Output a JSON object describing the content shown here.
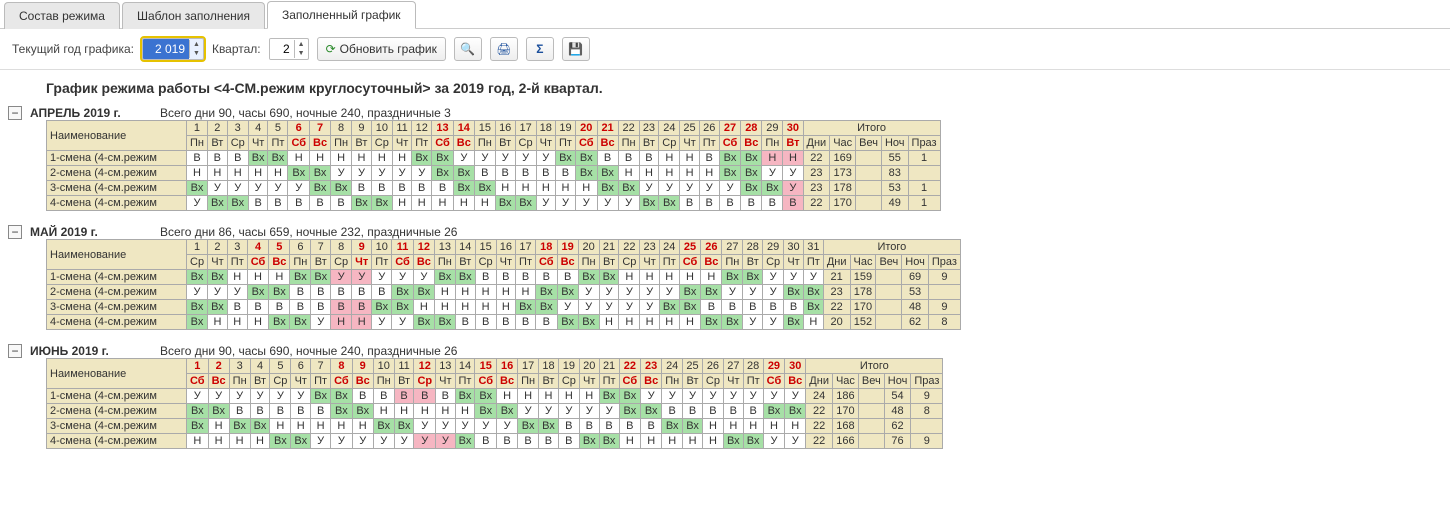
{
  "tabs": {
    "t0": "Состав режима",
    "t1": "Шаблон заполнения",
    "t2": "Заполненный график",
    "active": 2
  },
  "toolbar": {
    "year_label": "Текущий год графика:",
    "year": "2 019",
    "quarter_label": "Квартал:",
    "quarter": "2",
    "refresh": "Обновить график"
  },
  "title": "График режима работы <4-СМ.режим круглосуточный> за 2019 год, 2-й квартал.",
  "cols": {
    "name": "Наименование",
    "totals_header": "Итого",
    "totals": [
      "Дни",
      "Час",
      "Веч",
      "Ноч",
      "Праз"
    ]
  },
  "months": [
    {
      "name": "АПРЕЛЬ 2019 г.",
      "sub": "Всего дни 90, часы 690, ночные 240, праздничные 3",
      "day_nums": [
        "1",
        "2",
        "3",
        "4",
        "5",
        "6",
        "7",
        "8",
        "9",
        "10",
        "11",
        "12",
        "13",
        "14",
        "15",
        "16",
        "17",
        "18",
        "19",
        "20",
        "21",
        "22",
        "23",
        "24",
        "25",
        "26",
        "27",
        "28",
        "29",
        "30"
      ],
      "red_nums": [
        6,
        7,
        13,
        14,
        20,
        21,
        27,
        28,
        30
      ],
      "dows": [
        "Пн",
        "Вт",
        "Ср",
        "Чт",
        "Пт",
        "Сб",
        "Вс",
        "Пн",
        "Вт",
        "Ср",
        "Чт",
        "Пт",
        "Сб",
        "Вс",
        "Пн",
        "Вт",
        "Ср",
        "Чт",
        "Пт",
        "Сб",
        "Вс",
        "Пн",
        "Вт",
        "Ср",
        "Чт",
        "Пт",
        "Сб",
        "Вс",
        "Пн",
        "Вт"
      ],
      "red_dows": [
        6,
        7,
        13,
        14,
        20,
        21,
        27,
        28,
        30
      ],
      "rows": [
        {
          "name": "1-смена (4-см.режим",
          "cells": [
            "В",
            "В",
            "В",
            "Вх",
            "Вх",
            "Н",
            "Н",
            "Н",
            "Н",
            "Н",
            "Н",
            "Вх",
            "Вх",
            "У",
            "У",
            "У",
            "У",
            "У",
            "Вх",
            "Вх",
            "В",
            "В",
            "В",
            "Н",
            "Н",
            "В",
            "Вх",
            "Вх",
            "Н",
            "Н"
          ],
          "vx": [
            4,
            5,
            12,
            13,
            19,
            20,
            27,
            28
          ],
          "hol": [
            29,
            30
          ],
          "totals": [
            "22",
            "169",
            "",
            "55",
            "1"
          ]
        },
        {
          "name": "2-смена (4-см.режим",
          "cells": [
            "Н",
            "Н",
            "Н",
            "Н",
            "Н",
            "Вх",
            "Вх",
            "У",
            "У",
            "У",
            "У",
            "У",
            "Вх",
            "Вх",
            "В",
            "В",
            "В",
            "В",
            "В",
            "Вх",
            "Вх",
            "Н",
            "Н",
            "Н",
            "Н",
            "Н",
            "Вх",
            "Вх",
            "У",
            "У"
          ],
          "vx": [
            6,
            7,
            13,
            14,
            20,
            21,
            27,
            28
          ],
          "hol": [],
          "totals": [
            "23",
            "173",
            "",
            "83",
            ""
          ]
        },
        {
          "name": "3-смена (4-см.режим",
          "cells": [
            "Вх",
            "У",
            "У",
            "У",
            "У",
            "У",
            "Вх",
            "Вх",
            "В",
            "В",
            "В",
            "В",
            "В",
            "Вх",
            "Вх",
            "Н",
            "Н",
            "Н",
            "Н",
            "Н",
            "Вх",
            "Вх",
            "У",
            "У",
            "У",
            "У",
            "У",
            "Вх",
            "Вх",
            "У"
          ],
          "vx": [
            1,
            7,
            8,
            14,
            15,
            21,
            22,
            28,
            29
          ],
          "hol": [
            30
          ],
          "totals": [
            "23",
            "178",
            "",
            "53",
            "1"
          ]
        },
        {
          "name": "4-смена (4-см.режим",
          "cells": [
            "У",
            "Вх",
            "Вх",
            "В",
            "В",
            "В",
            "В",
            "В",
            "Вх",
            "Вх",
            "Н",
            "Н",
            "Н",
            "Н",
            "Н",
            "Вх",
            "Вх",
            "У",
            "У",
            "У",
            "У",
            "У",
            "Вх",
            "Вх",
            "В",
            "В",
            "В",
            "В",
            "В",
            "В"
          ],
          "vx": [
            2,
            3,
            9,
            10,
            16,
            17,
            23,
            24
          ],
          "hol": [
            30
          ],
          "totals": [
            "22",
            "170",
            "",
            "49",
            "1"
          ]
        }
      ]
    },
    {
      "name": "МАЙ 2019 г.",
      "sub": "Всего дни 86, часы 659, ночные 232, праздничные 26",
      "day_nums": [
        "1",
        "2",
        "3",
        "4",
        "5",
        "6",
        "7",
        "8",
        "9",
        "10",
        "11",
        "12",
        "13",
        "14",
        "15",
        "16",
        "17",
        "18",
        "19",
        "20",
        "21",
        "22",
        "23",
        "24",
        "25",
        "26",
        "27",
        "28",
        "29",
        "30",
        "31"
      ],
      "red_nums": [
        4,
        5,
        9,
        11,
        12,
        18,
        19,
        25,
        26
      ],
      "dows": [
        "Ср",
        "Чт",
        "Пт",
        "Сб",
        "Вс",
        "Пн",
        "Вт",
        "Ср",
        "Чт",
        "Пт",
        "Сб",
        "Вс",
        "Пн",
        "Вт",
        "Ср",
        "Чт",
        "Пт",
        "Сб",
        "Вс",
        "Пн",
        "Вт",
        "Ср",
        "Чт",
        "Пт",
        "Сб",
        "Вс",
        "Пн",
        "Вт",
        "Ср",
        "Чт",
        "Пт"
      ],
      "red_dows": [
        4,
        5,
        9,
        11,
        12,
        18,
        19,
        25,
        26
      ],
      "rows": [
        {
          "name": "1-смена (4-см.режим",
          "cells": [
            "Вх",
            "Вх",
            "Н",
            "Н",
            "Н",
            "Вх",
            "Вх",
            "У",
            "У",
            "У",
            "У",
            "У",
            "Вх",
            "Вх",
            "В",
            "В",
            "В",
            "В",
            "В",
            "Вх",
            "Вх",
            "Н",
            "Н",
            "Н",
            "Н",
            "Н",
            "Вх",
            "Вх",
            "У",
            "У",
            "У"
          ],
          "vx": [
            1,
            2,
            6,
            7,
            13,
            14,
            20,
            21,
            27,
            28
          ],
          "hol": [
            8,
            9
          ],
          "totals": [
            "21",
            "159",
            "",
            "69",
            "9"
          ]
        },
        {
          "name": "2-смена (4-см.режим",
          "cells": [
            "У",
            "У",
            "У",
            "Вх",
            "Вх",
            "В",
            "В",
            "В",
            "В",
            "В",
            "Вх",
            "Вх",
            "Н",
            "Н",
            "Н",
            "Н",
            "Н",
            "Вх",
            "Вх",
            "У",
            "У",
            "У",
            "У",
            "У",
            "Вх",
            "Вх",
            "У",
            "У",
            "У",
            "Вх",
            "Вх"
          ],
          "vx": [
            4,
            5,
            11,
            12,
            18,
            19,
            25,
            26,
            30,
            31
          ],
          "hol": [],
          "totals": [
            "23",
            "178",
            "",
            "53",
            ""
          ]
        },
        {
          "name": "3-смена (4-см.режим",
          "cells": [
            "Вх",
            "Вх",
            "В",
            "В",
            "В",
            "В",
            "В",
            "В",
            "В",
            "Вх",
            "Вх",
            "Н",
            "Н",
            "Н",
            "Н",
            "Н",
            "Вх",
            "Вх",
            "У",
            "У",
            "У",
            "У",
            "У",
            "Вх",
            "Вх",
            "В",
            "В",
            "В",
            "В",
            "В",
            "Вх"
          ],
          "vx": [
            1,
            2,
            10,
            11,
            17,
            18,
            24,
            25,
            31
          ],
          "hol": [
            8,
            9
          ],
          "totals": [
            "22",
            "170",
            "",
            "48",
            "9"
          ]
        },
        {
          "name": "4-смена (4-см.режим",
          "cells": [
            "Вх",
            "Н",
            "Н",
            "Н",
            "Вх",
            "Вх",
            "У",
            "Н",
            "Н",
            "У",
            "У",
            "Вх",
            "Вх",
            "В",
            "В",
            "В",
            "В",
            "В",
            "Вх",
            "Вх",
            "Н",
            "Н",
            "Н",
            "Н",
            "Н",
            "Вх",
            "Вх",
            "У",
            "У",
            "Вх",
            "Н"
          ],
          "vx": [
            1,
            5,
            6,
            12,
            13,
            19,
            20,
            26,
            27,
            30
          ],
          "hol": [
            8,
            9
          ],
          "totals": [
            "20",
            "152",
            "",
            "62",
            "8"
          ]
        }
      ]
    },
    {
      "name": "ИЮНЬ 2019 г.",
      "sub": "Всего дни 90, часы 690, ночные 240, праздничные 26",
      "day_nums": [
        "1",
        "2",
        "3",
        "4",
        "5",
        "6",
        "7",
        "8",
        "9",
        "10",
        "11",
        "12",
        "13",
        "14",
        "15",
        "16",
        "17",
        "18",
        "19",
        "20",
        "21",
        "22",
        "23",
        "24",
        "25",
        "26",
        "27",
        "28",
        "29",
        "30"
      ],
      "red_nums": [
        1,
        2,
        8,
        9,
        12,
        15,
        16,
        22,
        23,
        29,
        30
      ],
      "dows": [
        "Сб",
        "Вс",
        "Пн",
        "Вт",
        "Ср",
        "Чт",
        "Пт",
        "Сб",
        "Вс",
        "Пн",
        "Вт",
        "Ср",
        "Чт",
        "Пт",
        "Сб",
        "Вс",
        "Пн",
        "Вт",
        "Ср",
        "Чт",
        "Пт",
        "Сб",
        "Вс",
        "Пн",
        "Вт",
        "Ср",
        "Чт",
        "Пт",
        "Сб",
        "Вс"
      ],
      "red_dows": [
        1,
        2,
        8,
        9,
        12,
        15,
        16,
        22,
        23,
        29,
        30
      ],
      "rows": [
        {
          "name": "1-смена (4-см.режим",
          "cells": [
            "У",
            "У",
            "У",
            "У",
            "У",
            "У",
            "Вх",
            "Вх",
            "В",
            "В",
            "В",
            "В",
            "В",
            "Вх",
            "Вх",
            "Н",
            "Н",
            "Н",
            "Н",
            "Н",
            "Вх",
            "Вх",
            "У",
            "У",
            "У",
            "У",
            "У",
            "У",
            "У",
            "У"
          ],
          "vx": [
            7,
            8,
            14,
            15,
            21,
            22
          ],
          "hol": [
            11,
            12
          ],
          "totals": [
            "24",
            "186",
            "",
            "54",
            "9"
          ]
        },
        {
          "name": "2-смена (4-см.режим",
          "cells": [
            "Вх",
            "Вх",
            "В",
            "В",
            "В",
            "В",
            "В",
            "Вх",
            "Вх",
            "Н",
            "Н",
            "Н",
            "Н",
            "Н",
            "Вх",
            "Вх",
            "У",
            "У",
            "У",
            "У",
            "У",
            "Вх",
            "Вх",
            "В",
            "В",
            "В",
            "В",
            "В",
            "Вх",
            "Вх"
          ],
          "vx": [
            1,
            2,
            8,
            9,
            15,
            16,
            22,
            23,
            29,
            30
          ],
          "hol": [],
          "totals": [
            "22",
            "170",
            "",
            "48",
            "8"
          ]
        },
        {
          "name": "3-смена (4-см.режим",
          "cells": [
            "Вх",
            "Н",
            "Вх",
            "Вх",
            "Н",
            "Н",
            "Н",
            "Н",
            "Н",
            "Вх",
            "Вх",
            "У",
            "У",
            "У",
            "У",
            "У",
            "Вх",
            "Вх",
            "В",
            "В",
            "В",
            "В",
            "В",
            "Вх",
            "Вх",
            "Н",
            "Н",
            "Н",
            "Н",
            "Н"
          ],
          "vx": [
            1,
            3,
            4,
            10,
            11,
            17,
            18,
            24,
            25
          ],
          "hol": [],
          "totals": [
            "22",
            "168",
            "",
            "62",
            ""
          ]
        },
        {
          "name": "4-смена (4-см.режим",
          "cells": [
            "Н",
            "Н",
            "Н",
            "Н",
            "Вх",
            "Вх",
            "У",
            "У",
            "У",
            "У",
            "У",
            "У",
            "У",
            "Вх",
            "В",
            "В",
            "В",
            "В",
            "В",
            "Вх",
            "Вх",
            "Н",
            "Н",
            "Н",
            "Н",
            "Н",
            "Вх",
            "Вх",
            "У",
            "У"
          ],
          "vx": [
            5,
            6,
            14,
            20,
            21,
            27,
            28
          ],
          "hol": [
            12,
            13
          ],
          "totals": [
            "22",
            "166",
            "",
            "76",
            "9"
          ]
        }
      ]
    }
  ]
}
